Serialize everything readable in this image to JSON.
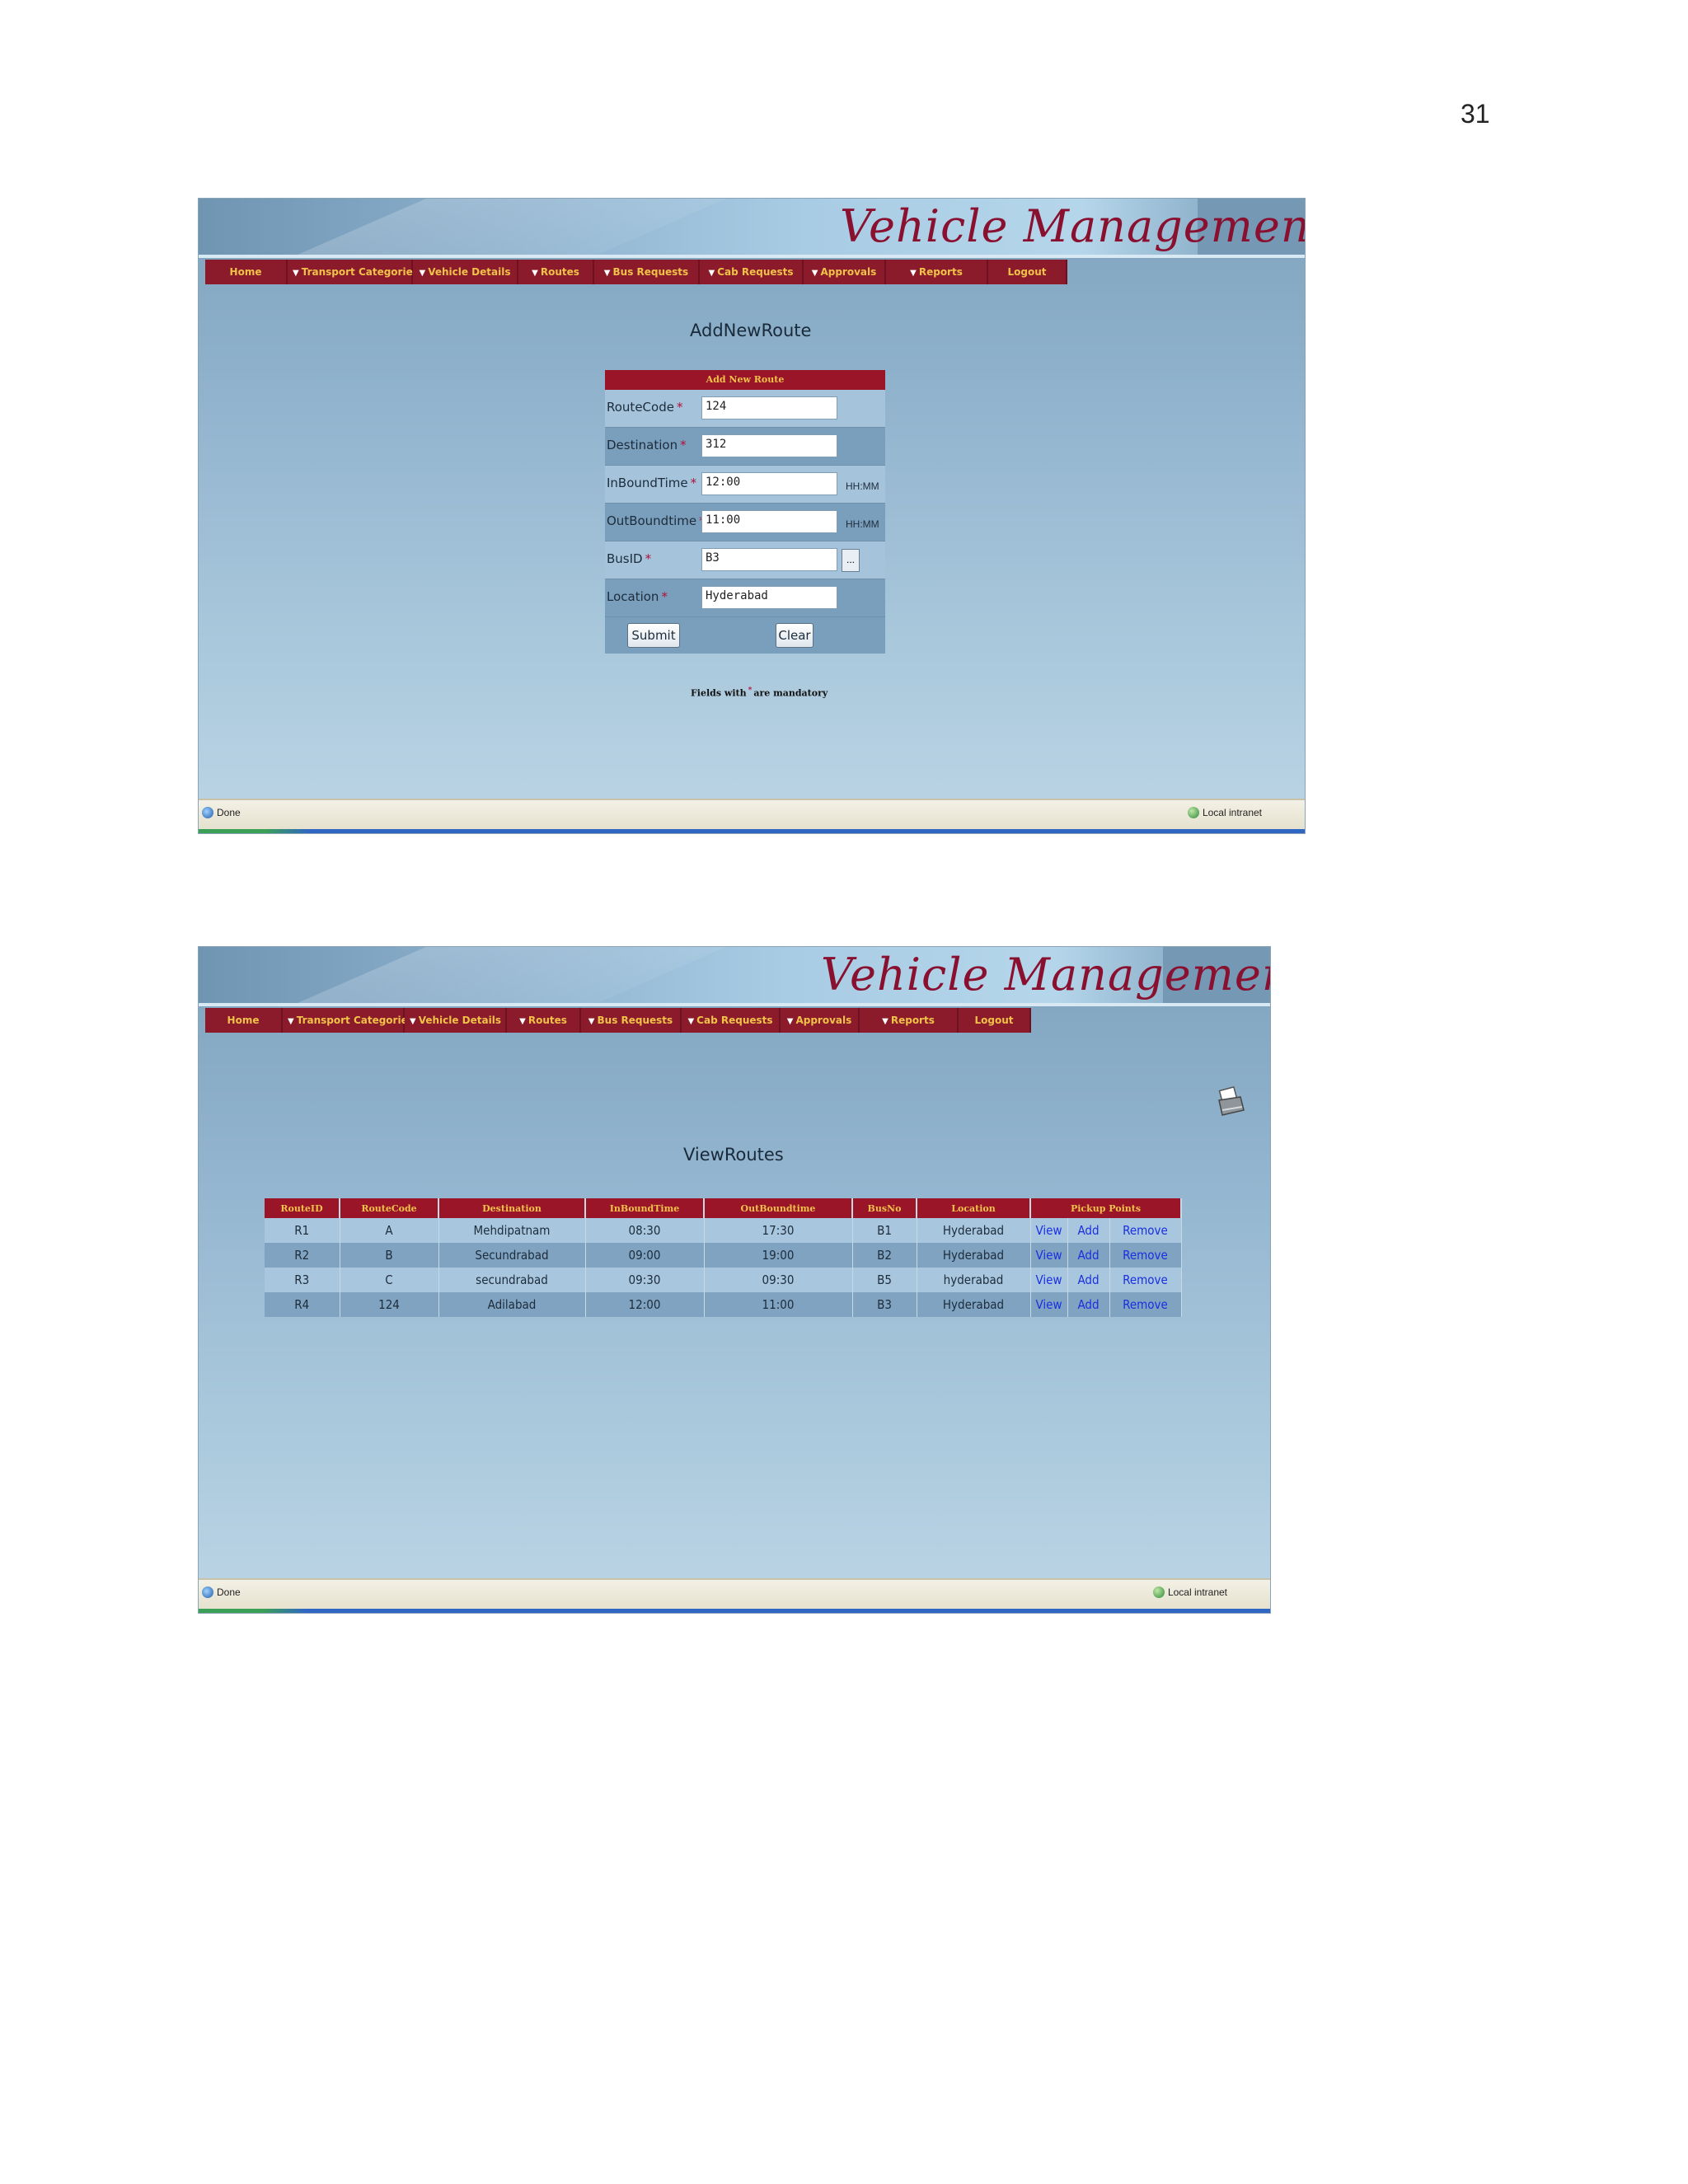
{
  "page_number": "31",
  "app": {
    "banner_title": "Vehicle Management",
    "menu": [
      {
        "label": "Home",
        "arrow": false
      },
      {
        "label": "Transport Categories",
        "arrow": true
      },
      {
        "label": "Vehicle Details",
        "arrow": true
      },
      {
        "label": "Routes",
        "arrow": true
      },
      {
        "label": "Bus Requests",
        "arrow": true
      },
      {
        "label": "Cab Requests",
        "arrow": true
      },
      {
        "label": "Approvals",
        "arrow": true
      },
      {
        "label": "Reports",
        "arrow": true
      },
      {
        "label": "Logout",
        "arrow": false
      }
    ],
    "status_left": "Done",
    "status_right": "Local intranet"
  },
  "add_route": {
    "heading": "AddNewRoute",
    "form_title": "Add New Route",
    "fields": [
      {
        "label": "RouteCode",
        "value": "124",
        "hint": ""
      },
      {
        "label": "Destination",
        "value": "312",
        "hint": ""
      },
      {
        "label": "InBoundTime",
        "value": "12:00",
        "hint": "HH:MM"
      },
      {
        "label": "OutBoundtime",
        "value": "11:00",
        "hint": "HH:MM"
      },
      {
        "label": "BusID",
        "value": "B3",
        "hint": ""
      },
      {
        "label": "Location",
        "value": "Hyderabad",
        "hint": ""
      }
    ],
    "required_mark": "*",
    "submit_label": "Submit",
    "clear_label": "Clear",
    "lookup_label": "...",
    "note_before": "Fields with",
    "note_after": "are mandatory"
  },
  "view_routes": {
    "heading": "ViewRoutes",
    "columns": [
      "RouteID",
      "RouteCode",
      "Destination",
      "InBoundTime",
      "OutBoundtime",
      "BusNo",
      "Location",
      "Pickup Points"
    ],
    "rows": [
      [
        "R1",
        "A",
        "Mehdipatnam",
        "08:30",
        "17:30",
        "B1",
        "Hyderabad"
      ],
      [
        "R2",
        "B",
        "Secundrabad",
        "09:00",
        "19:00",
        "B2",
        "Hyderabad"
      ],
      [
        "R3",
        "C",
        "secundrabad",
        "09:30",
        "09:30",
        "B5",
        "hyderabad"
      ],
      [
        "R4",
        "124",
        "Adilabad",
        "12:00",
        "11:00",
        "B3",
        "Hyderabad"
      ]
    ],
    "row_actions": [
      "View",
      "Add",
      "Remove"
    ]
  }
}
